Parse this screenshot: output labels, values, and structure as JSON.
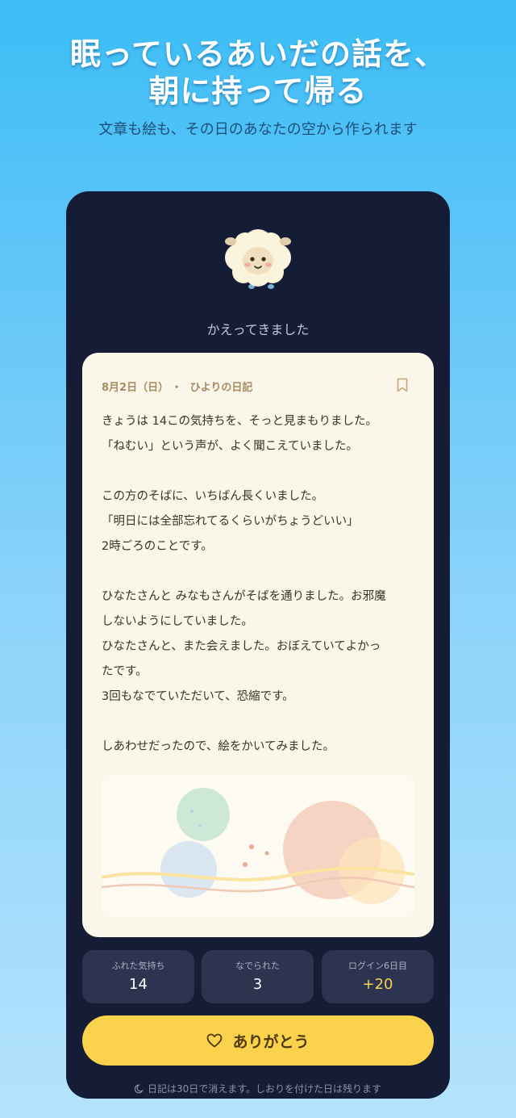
{
  "hero": {
    "title_line1": "眠っているあいだの話を、",
    "title_line2": "朝に持って帰る",
    "subtitle": "文章も絵も、その日のあなたの空から作られます"
  },
  "screen": {
    "returned_label": "かえってきました",
    "diary": {
      "date": "8月2日（日）",
      "separator": "・",
      "author": "ひよりの日記",
      "lines": [
        "きょうは 14この気持ちを、そっと見まもりました。",
        "「ねむい」という声が、よく聞こえていました。",
        "",
        "この方のそばに、いちばん長くいました。",
        "「明日には全部忘れてるくらいがちょうどいい」",
        "2時ごろのことです。",
        "",
        "ひなたさんと みなもさんがそばを通りました。お邪魔",
        "しないようにしていました。",
        "ひなたさんと、また会えました。おぼえていてよかっ",
        "たです。",
        "3回もなでていただいて、恐縮です。",
        "",
        "しあわせだったので、絵をかいてみました。"
      ]
    },
    "stats": [
      {
        "label": "ふれた気持ち",
        "value": "14"
      },
      {
        "label": "なでられた",
        "value": "3"
      },
      {
        "label": "ログイン6日目",
        "value": "+20"
      }
    ],
    "thanks_button": "ありがとう",
    "footer_note": "日記は30日で消えます。しおりを付けた日は残ります"
  },
  "colors": {
    "accent": "#fbd24b",
    "panel": "#151c36",
    "paper": "#fbf6ea",
    "bonus": "#f7d257"
  },
  "icons": [
    "sheep-mascot",
    "bookmark-icon",
    "heart-icon",
    "moon-icon"
  ]
}
